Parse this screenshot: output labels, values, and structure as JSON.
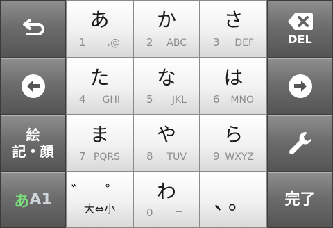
{
  "left": {
    "undo_icon": "undo-arrow",
    "left_icon": "circle-arrow-left",
    "emoji_label_line1": "絵",
    "emoji_label_line2": "記・顔",
    "mode_label_a": "あ",
    "mode_label_b": "A1"
  },
  "right": {
    "del_label": "DEL",
    "right_icon": "circle-arrow-right",
    "settings_icon": "wrench",
    "enter_label": "完了"
  },
  "keys": [
    {
      "kana": "あ",
      "num": "1",
      "alpha": ".@"
    },
    {
      "kana": "か",
      "num": "2",
      "alpha": "ABC"
    },
    {
      "kana": "さ",
      "num": "3",
      "alpha": "DEF"
    },
    {
      "kana": "た",
      "num": "4",
      "alpha": "GHI"
    },
    {
      "kana": "な",
      "num": "5",
      "alpha": "JKL"
    },
    {
      "kana": "は",
      "num": "6",
      "alpha": "MNO"
    },
    {
      "kana": "ま",
      "num": "7",
      "alpha": "PQRS"
    },
    {
      "kana": "や",
      "num": "8",
      "alpha": "TUV"
    },
    {
      "kana": "ら",
      "num": "9",
      "alpha": "WXYZ"
    },
    {
      "kana": "わ",
      "num": "0",
      "alpha": "－"
    }
  ],
  "special": {
    "dakuten": "゛ ゜",
    "daisho": "大⇔小",
    "punct": "、。"
  },
  "colors": {
    "mode_accent": "#7bdc7b",
    "side_key": "#6d6d6d",
    "main_key": "#f1f1f1"
  }
}
